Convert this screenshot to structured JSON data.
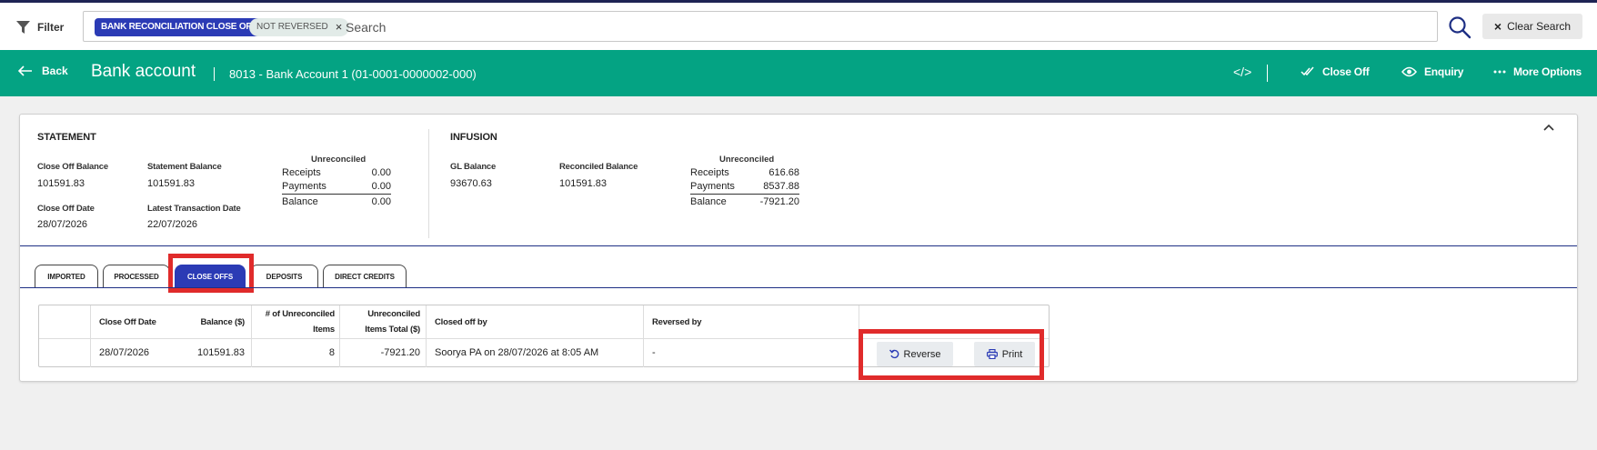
{
  "filter_bar": {
    "filter_label": "Filter",
    "chips": {
      "primary": "BANK RECONCILIATION CLOSE OFF",
      "secondary": "NOT REVERSED",
      "remove_symbol": "×"
    },
    "search_placeholder": "Search",
    "clear_search_label": "Clear Search",
    "clear_icon": "×"
  },
  "header": {
    "back_label": "Back",
    "title": "Bank account",
    "account": "8013 - Bank Account 1 (01-0001-0000002-000)",
    "code_symbol": "</>",
    "actions": {
      "close_off": "Close Off",
      "enquiry": "Enquiry",
      "more_options": "More Options"
    }
  },
  "statement": {
    "title": "STATEMENT",
    "close_off_balance_label": "Close Off Balance",
    "close_off_balance": "101591.83",
    "statement_balance_label": "Statement Balance",
    "statement_balance": "101591.83",
    "close_off_date_label": "Close Off Date",
    "close_off_date": "28/07/2026",
    "latest_transaction_date_label": "Latest Transaction Date",
    "latest_transaction_date": "22/07/2026",
    "unreconciled": {
      "title": "Unreconciled",
      "receipts_label": "Receipts",
      "receipts": "0.00",
      "payments_label": "Payments",
      "payments": "0.00",
      "balance_label": "Balance",
      "balance": "0.00"
    }
  },
  "infusion": {
    "title": "INFUSION",
    "gl_balance_label": "GL Balance",
    "gl_balance": "93670.63",
    "reconciled_balance_label": "Reconciled Balance",
    "reconciled_balance": "101591.83",
    "unreconciled": {
      "title": "Unreconciled",
      "receipts_label": "Receipts",
      "receipts": "616.68",
      "payments_label": "Payments",
      "payments": "8537.88",
      "balance_label": "Balance",
      "balance": "-7921.20"
    }
  },
  "tabs": [
    "IMPORTED",
    "PROCESSED",
    "CLOSE OFFS",
    "DEPOSITS",
    "DIRECT CREDITS"
  ],
  "active_tab": "CLOSE OFFS",
  "table": {
    "headers": {
      "close_off_date": "Close Off Date",
      "balance": "Balance ($)",
      "unreconciled_items_1": "# of Unreconciled",
      "unreconciled_items_2": "Items",
      "unreconciled_total_1": "Unreconciled",
      "unreconciled_total_2": "Items Total ($)",
      "closed_off_by": "Closed off by",
      "reversed_by": "Reversed by"
    },
    "rows": [
      {
        "close_off_date": "28/07/2026",
        "balance": "101591.83",
        "unreconciled_items": "8",
        "unreconciled_total": "-7921.20",
        "closed_off_by": "Soorya PA on 28/07/2026 at 8:05 AM",
        "reversed_by": "-",
        "reverse_label": "Reverse",
        "print_label": "Print"
      }
    ]
  },
  "colors": {
    "header_green": "#04a383",
    "accent_blue": "#2b3bb5",
    "highlight_red": "#e02b2b",
    "top_line": "#1e2454"
  }
}
